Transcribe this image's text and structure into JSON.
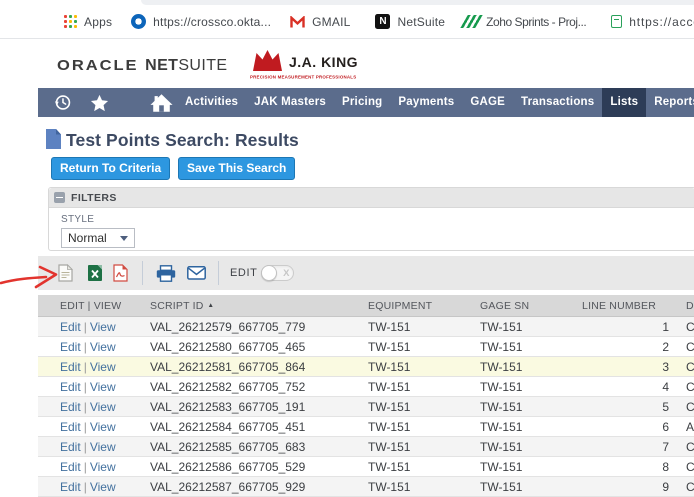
{
  "browser": {
    "bookmarks": [
      {
        "icon": "apps-grid-icon",
        "label": "Apps"
      },
      {
        "icon": "okta-icon",
        "label": "https://crossco.okta..."
      },
      {
        "icon": "gmail-icon",
        "label": "GMAIL"
      },
      {
        "icon": "netsuite-icon",
        "label": "NetSuite"
      },
      {
        "icon": "zoho-sprints-icon",
        "label": "Zoho Sprints - Proj..."
      },
      {
        "icon": "green-doc-icon",
        "label": "https://account"
      }
    ],
    "netsuite_icon_letter": "N"
  },
  "brand": {
    "oracle": "ORACLE",
    "net": "NET",
    "suite": "SUITE",
    "jak_name": "J.A. KING",
    "jak_tagline": "PRECISION MEASUREMENT PROFESSIONALS"
  },
  "nav": {
    "items": [
      "Activities",
      "JAK Masters",
      "Pricing",
      "Payments",
      "GAGE",
      "Transactions",
      "Lists",
      "Reports"
    ],
    "active": "Lists"
  },
  "page": {
    "title": "Test Points Search: Results",
    "return_button": "Return To Criteria",
    "save_button": "Save This Search"
  },
  "filters": {
    "title": "FILTERS",
    "style_label": "STYLE",
    "style_value": "Normal"
  },
  "toolbar": {
    "edit_label": "EDIT",
    "icons": [
      "csv-file-icon",
      "excel-icon",
      "pdf-icon",
      "print-icon",
      "email-icon"
    ]
  },
  "table": {
    "headers": {
      "edit_view": "EDIT | VIEW",
      "script_id": "SCRIPT ID",
      "equipment": "EQUIPMENT",
      "gage_sn": "GAGE SN",
      "line_number": "LINE NUMBER",
      "description": "DE"
    },
    "sorted_by": "SCRIPT ID",
    "edit_label": "Edit",
    "view_label": "View",
    "rows": [
      {
        "script_id": "VAL_26212579_667705_779",
        "equipment": "TW-151",
        "gage_sn": "TW-151",
        "line_number": "1",
        "description": "CW",
        "shade": "gray"
      },
      {
        "script_id": "VAL_26212580_667705_465",
        "equipment": "TW-151",
        "gage_sn": "TW-151",
        "line_number": "2",
        "description": "CW",
        "shade": "white"
      },
      {
        "script_id": "VAL_26212581_667705_864",
        "equipment": "TW-151",
        "gage_sn": "TW-151",
        "line_number": "3",
        "description": "CW",
        "shade": "yellow"
      },
      {
        "script_id": "VAL_26212582_667705_752",
        "equipment": "TW-151",
        "gage_sn": "TW-151",
        "line_number": "4",
        "description": "CW",
        "shade": "white"
      },
      {
        "script_id": "VAL_26212583_667705_191",
        "equipment": "TW-151",
        "gage_sn": "TW-151",
        "line_number": "5",
        "description": "CW",
        "shade": "gray"
      },
      {
        "script_id": "VAL_26212584_667705_451",
        "equipment": "TW-151",
        "gage_sn": "TW-151",
        "line_number": "6",
        "description": "Av",
        "shade": "white"
      },
      {
        "script_id": "VAL_26212585_667705_683",
        "equipment": "TW-151",
        "gage_sn": "TW-151",
        "line_number": "7",
        "description": "CW",
        "shade": "gray"
      },
      {
        "script_id": "VAL_26212586_667705_529",
        "equipment": "TW-151",
        "gage_sn": "TW-151",
        "line_number": "8",
        "description": "CW",
        "shade": "white"
      },
      {
        "script_id": "VAL_26212587_667705_929",
        "equipment": "TW-151",
        "gage_sn": "TW-151",
        "line_number": "9",
        "description": "CW",
        "shade": "gray"
      }
    ]
  },
  "annotation": {
    "arrow_color": "#e2342e"
  },
  "colors": {
    "nav_bg": "#5b6c8c",
    "nav_active_bg": "#2d3c57",
    "button_blue": "#2d97e0",
    "row_highlight": "#fafae1",
    "link_blue": "#42709e"
  }
}
